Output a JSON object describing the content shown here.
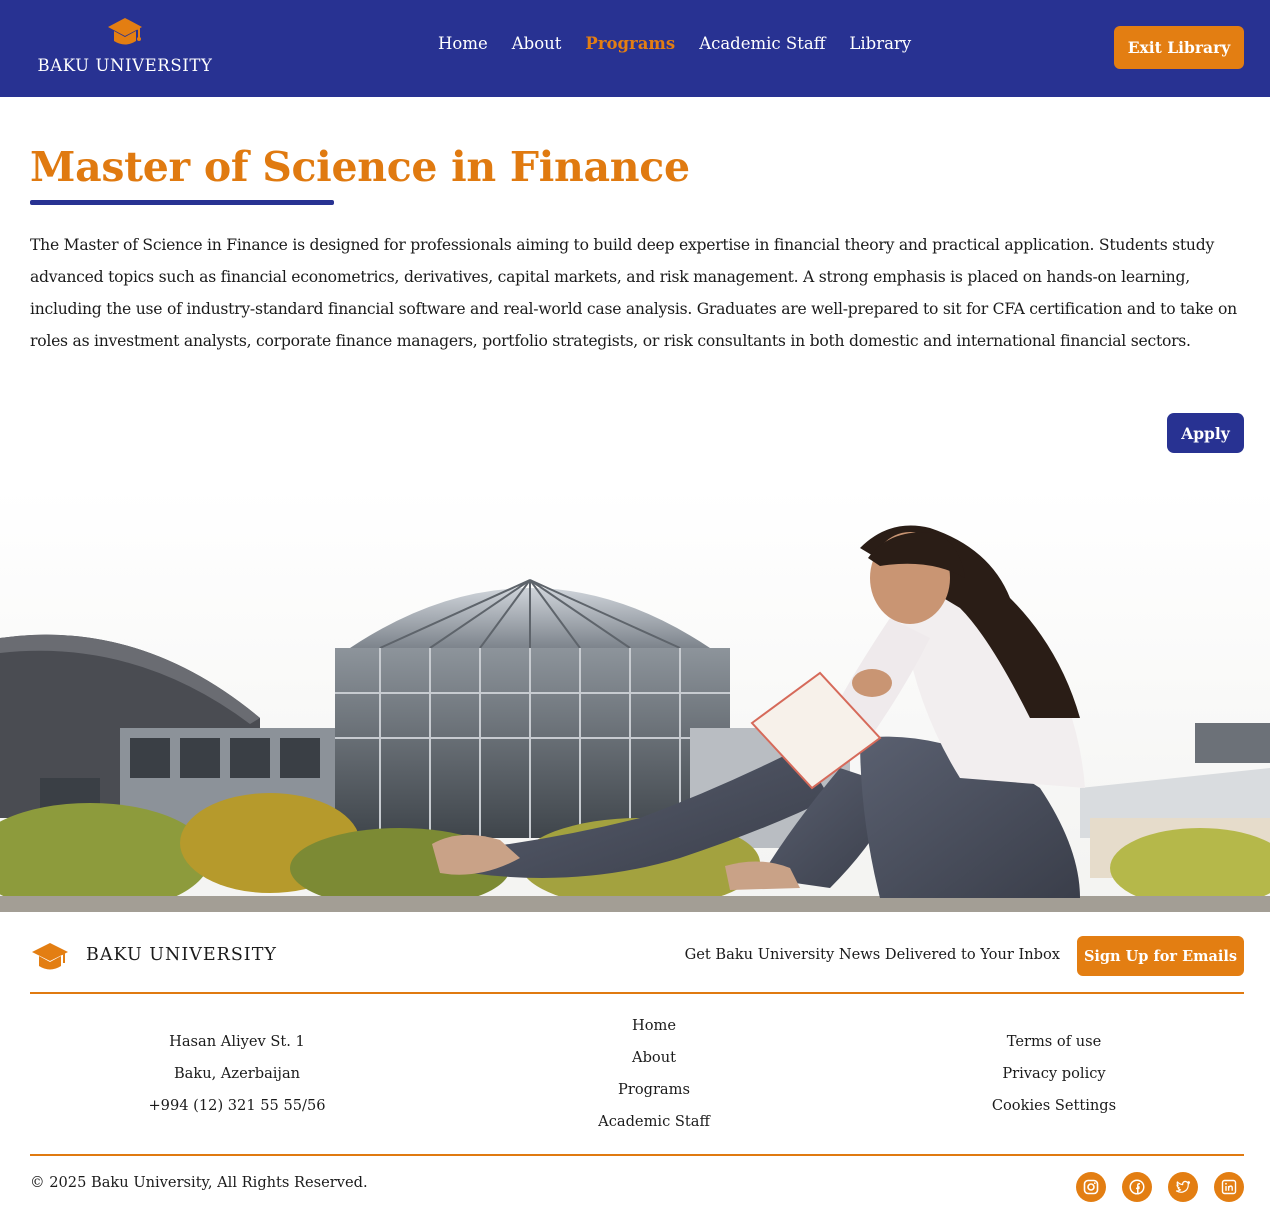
{
  "header": {
    "logo_text": "BAKU UNIVERSITY",
    "nav": [
      {
        "label": "Home",
        "active": false
      },
      {
        "label": "About",
        "active": false
      },
      {
        "label": "Programs",
        "active": true
      },
      {
        "label": "Academic Staff",
        "active": false
      },
      {
        "label": "Library",
        "active": false
      }
    ],
    "exit_button": "Exit Library"
  },
  "main": {
    "title": "Master of Science in Finance",
    "description": "The Master of Science in Finance is designed for professionals aiming to build deep expertise in financial theory and practical application. Students study advanced topics such as financial econometrics, derivatives, capital markets, and risk management. A strong emphasis is placed on hands-on learning, including the use of industry-standard financial software and real-world case analysis. Graduates are well-prepared to sit for CFA certification and to take on roles as investment analysts, corporate finance managers, portfolio strategists, or risk consultants in both domestic and international financial sectors.",
    "apply_button": "Apply"
  },
  "footer": {
    "logo_text": "BAKU UNIVERSITY",
    "newsletter_text": "Get Baku University News Delivered to Your Inbox",
    "signup_button": "Sign Up for Emails",
    "address": [
      "Hasan Aliyev St. 1",
      "Baku, Azerbaijan",
      "+994 (12) 321 55 55/56"
    ],
    "links": [
      "Home",
      "About",
      "Programs",
      "Academic Staff"
    ],
    "legal": [
      "Terms of use",
      "Privacy policy",
      "Cookies Settings"
    ],
    "copyright": "© 2025 Baku University, All Rights Reserved.",
    "social": [
      "instagram-icon",
      "facebook-icon",
      "twitter-icon",
      "linkedin-icon"
    ]
  },
  "colors": {
    "primary": "#283292",
    "accent": "#e37e12",
    "text": "#1b1b1b"
  }
}
